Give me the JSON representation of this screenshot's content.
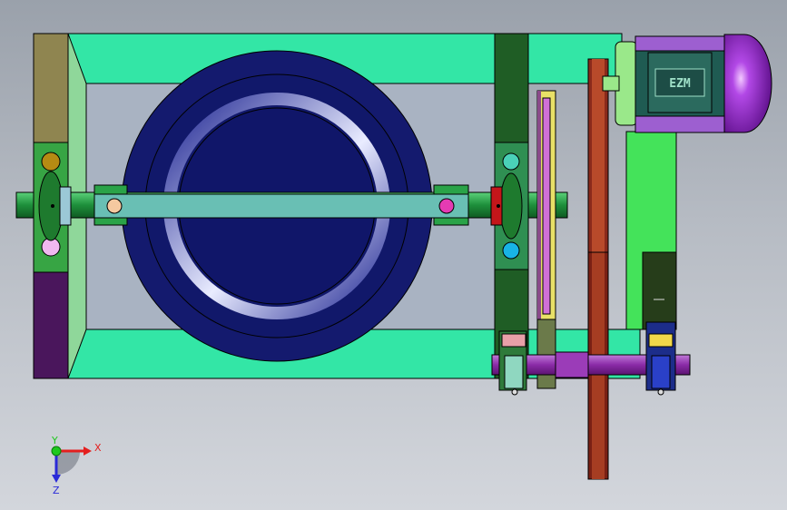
{
  "view": {
    "colors": {
      "background_top": "#9aa1ab",
      "background_bottom": "#d3d6dc",
      "frame_green": "#33e6a6",
      "frame_outline": "#000000",
      "frame_inner": "#a7b2c0",
      "drum_blue": "#141a6e",
      "drum_ring": "#c8cde8",
      "shaft_green": "#1e8f3b",
      "arm_teal": "#69bfb4",
      "belt_red": "#8a2a1b",
      "pulley_yellow": "#e8e067",
      "pulley_magenta": "#d070d6",
      "motor_purple": "#9528c8",
      "motor_teal": "#1f5b52",
      "shaft_purple": "#8b2ba8",
      "bearing_blue": "#1c2d8a"
    }
  },
  "motor": {
    "nameplate": "EZM",
    "icon": "motor-icon"
  },
  "triad": {
    "x_label": "X",
    "y_label": "Y",
    "z_label": "Z",
    "x_color": "#e41f1f",
    "y_color": "#1ec81e",
    "z_color": "#2a2ad8"
  }
}
